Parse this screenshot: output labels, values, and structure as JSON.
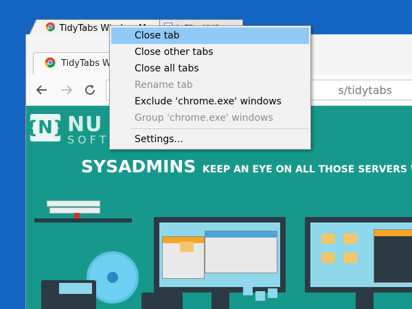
{
  "tidytabs": {
    "tabs": [
      {
        "title": "TidyTabs Window Ma",
        "icon": "chrome-icon"
      },
      {
        "title": "無題 - 記檔",
        "icon": "notepad-icon"
      }
    ]
  },
  "browser": {
    "tab": {
      "title": "TidyTabs W",
      "icon": "chrome-icon"
    },
    "toolbar": {
      "back_icon": "back-arrow-icon",
      "forward_icon": "forward-arrow-icon",
      "reload_icon": "reload-icon",
      "url_tail": "s/tidytabs"
    }
  },
  "context_menu": {
    "items": [
      {
        "label": "Close tab",
        "state": "highlighted"
      },
      {
        "label": "Close other tabs",
        "state": "enabled"
      },
      {
        "label": "Close all tabs",
        "state": "enabled"
      },
      {
        "label": "Rename tab",
        "state": "disabled"
      },
      {
        "label": "Exclude 'chrome.exe' windows",
        "state": "enabled"
      },
      {
        "label": "Group 'chrome.exe' windows",
        "state": "disabled"
      },
      {
        "label": "Settings...",
        "state": "enabled"
      }
    ]
  },
  "page": {
    "logo_mark": "{N}",
    "logo_text": "NU",
    "logo_sub": "SOFT",
    "hero_big": "SYSADMINS",
    "hero_small": "KEEP AN EYE ON ALL THOSE SERVERS WITH"
  },
  "colors": {
    "desktop": "#1565c0",
    "page_teal": "#16998a",
    "menu_highlight": "#91c9f7",
    "disabled_text": "#8d8d8d"
  }
}
